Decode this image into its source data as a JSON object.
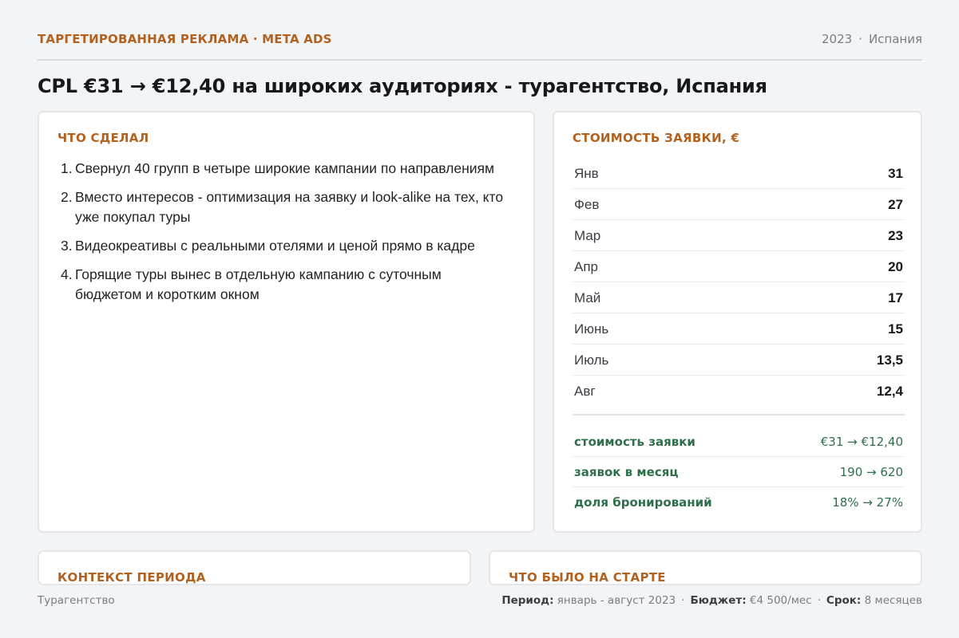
{
  "header": {
    "kicker": "ТАРГЕТИРОВАННАЯ РЕКЛАМА · META ADS",
    "year": "2023",
    "separator": "·",
    "country": "Испания"
  },
  "headline": "CPL €31 → €12,40 на широких аудиториях - турагентство, Испания",
  "actions": {
    "title": "ЧТО СДЕЛАЛ",
    "items": [
      {
        "num": "1.",
        "text": "Свернул 40 групп в четыре широкие кампании по направлениям"
      },
      {
        "num": "2.",
        "text": "Вместо интересов - оптимизация на заявку и look-alike на тех, кто уже покупал туры"
      },
      {
        "num": "3.",
        "text": "Видеокреативы с реальными отелями и ценой прямо в кадре"
      },
      {
        "num": "4.",
        "text": "Горящие туры вынес в отдельную кампанию с суточным бюджетом и коротким окном"
      }
    ]
  },
  "cost": {
    "title": "СТОИМОСТЬ ЗАЯВКИ, €",
    "months": [
      {
        "name": "Янв",
        "value": "31"
      },
      {
        "name": "Фев",
        "value": "27"
      },
      {
        "name": "Мар",
        "value": "23"
      },
      {
        "name": "Апр",
        "value": "20"
      },
      {
        "name": "Май",
        "value": "17"
      },
      {
        "name": "Июнь",
        "value": "15"
      },
      {
        "name": "Июль",
        "value": "13,5"
      },
      {
        "name": "Авг",
        "value": "12,4"
      }
    ],
    "results": [
      {
        "name": "стоимость заявки",
        "value": "€31 → €12,40"
      },
      {
        "name": "заявок в месяц",
        "value": "190 → 620"
      },
      {
        "name": "доля бронирований",
        "value": "18% → 27%"
      }
    ]
  },
  "context": {
    "title": "КОНТЕКСТ ПЕРИОДА"
  },
  "start": {
    "title": "ЧТО БЫЛО НА СТАРТЕ"
  },
  "footer": {
    "client": "Турагентство",
    "period_label": "Период:",
    "period_value": "январь - август 2023",
    "budget_label": "Бюджет:",
    "budget_value": "€4 500/мес",
    "term_label": "Срок:",
    "term_value": "8 месяцев",
    "separator": "·"
  },
  "colors": {
    "accent": "#b3611f",
    "result": "#2f6e4a",
    "background": "#f3f4f6",
    "card": "#ffffff"
  }
}
